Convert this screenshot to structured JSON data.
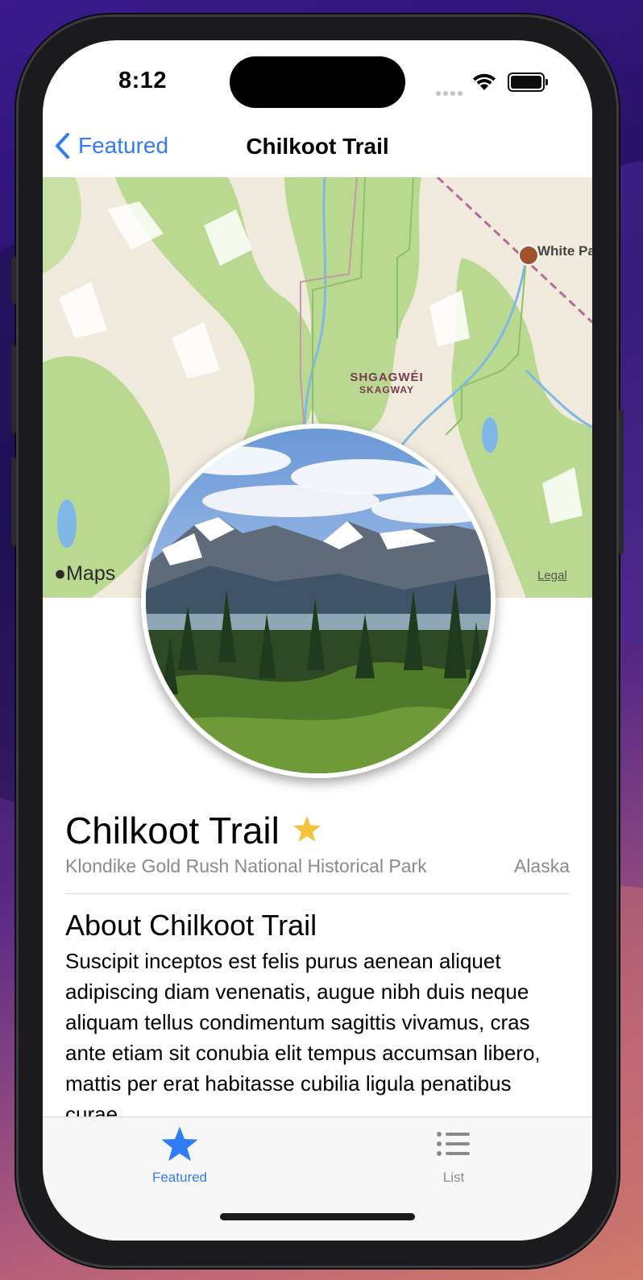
{
  "status_bar": {
    "time": "8:12",
    "icons": [
      "signal-dots-icon",
      "wifi-icon",
      "battery-icon"
    ]
  },
  "nav": {
    "back_label": "Featured",
    "title": "Chilkoot Trail"
  },
  "map": {
    "town_label_1": "SHGAGWÉI",
    "town_label_2": "SKAGWAY",
    "poi_label": "White Pa",
    "attribution": "Maps",
    "legal_label": "Legal"
  },
  "landmark": {
    "name": "Chilkoot Trail",
    "is_favorite": true,
    "park": "Klondike Gold Rush National Historical Park",
    "state": "Alaska",
    "about_title": "About Chilkoot Trail",
    "description": "Suscipit inceptos est felis purus aenean aliquet adipiscing diam venenatis, augue nibh duis neque aliquam tellus condimentum sagittis vivamus, cras ante etiam sit conubia elit tempus accumsan libero, mattis per erat habitasse cubilia ligula penatibus curae."
  },
  "tabbar": {
    "tabs": [
      {
        "label": "Featured",
        "icon": "star-icon",
        "selected": true
      },
      {
        "label": "List",
        "icon": "list-icon",
        "selected": false
      }
    ]
  },
  "colors": {
    "accent": "#2f7cf6",
    "favorite_star": "#f5c33b",
    "secondary_text": "#8a8a8e"
  }
}
